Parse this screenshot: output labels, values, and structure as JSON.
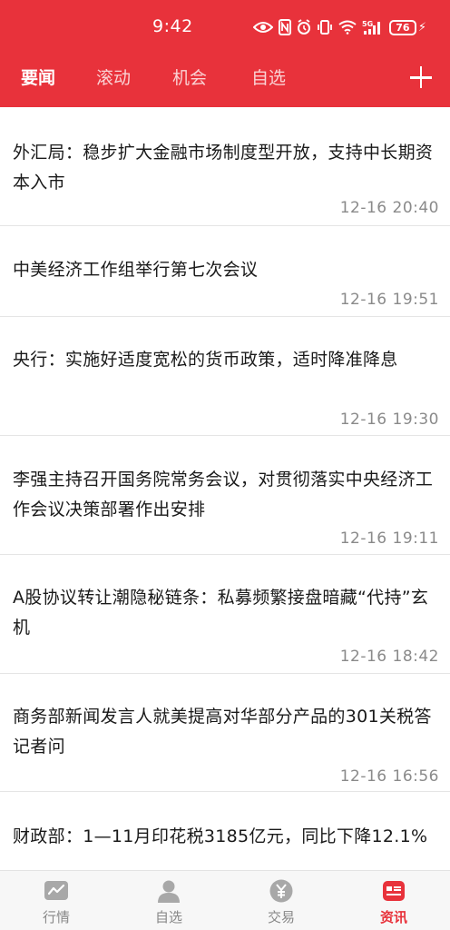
{
  "status_bar": {
    "time": "9:42",
    "battery_level": "76",
    "network": "5G"
  },
  "tabs": [
    {
      "label": "要闻",
      "active": true
    },
    {
      "label": "滚动",
      "active": false
    },
    {
      "label": "机会",
      "active": false
    },
    {
      "label": "自选",
      "active": false
    }
  ],
  "add_button_label": "+",
  "news": [
    {
      "title": "外汇局：稳步扩大金融市场制度型开放，支持中长期资本入市",
      "time": "12-16 20:40"
    },
    {
      "title": "中美经济工作组举行第七次会议",
      "time": "12-16 19:51"
    },
    {
      "title": "央行：实施好适度宽松的货币政策，适时降准降息",
      "time": "12-16 19:30"
    },
    {
      "title": "李强主持召开国务院常务会议，对贯彻落实中央经济工作会议决策部署作出安排",
      "time": "12-16 19:11"
    },
    {
      "title": "A股协议转让潮隐秘链条：私募频繁接盘暗藏“代持”玄机",
      "time": "12-16 18:42"
    },
    {
      "title": "商务部新闻发言人就美提高对华部分产品的301关税答记者问",
      "time": "12-16 16:56"
    },
    {
      "title": "财政部：1—11月印花税3185亿元，同比下降12.1%",
      "time": ""
    }
  ],
  "bottom_nav": [
    {
      "label": "行情",
      "icon": "chart-icon",
      "active": false
    },
    {
      "label": "自选",
      "icon": "person-icon",
      "active": false
    },
    {
      "label": "交易",
      "icon": "yen-coin-icon",
      "active": false
    },
    {
      "label": "资讯",
      "icon": "news-icon",
      "active": true
    }
  ],
  "colors": {
    "brand_red": "#E8323B",
    "text_primary": "#1a1a1a",
    "text_secondary": "#8a8a8a",
    "nav_inactive": "#888888"
  }
}
